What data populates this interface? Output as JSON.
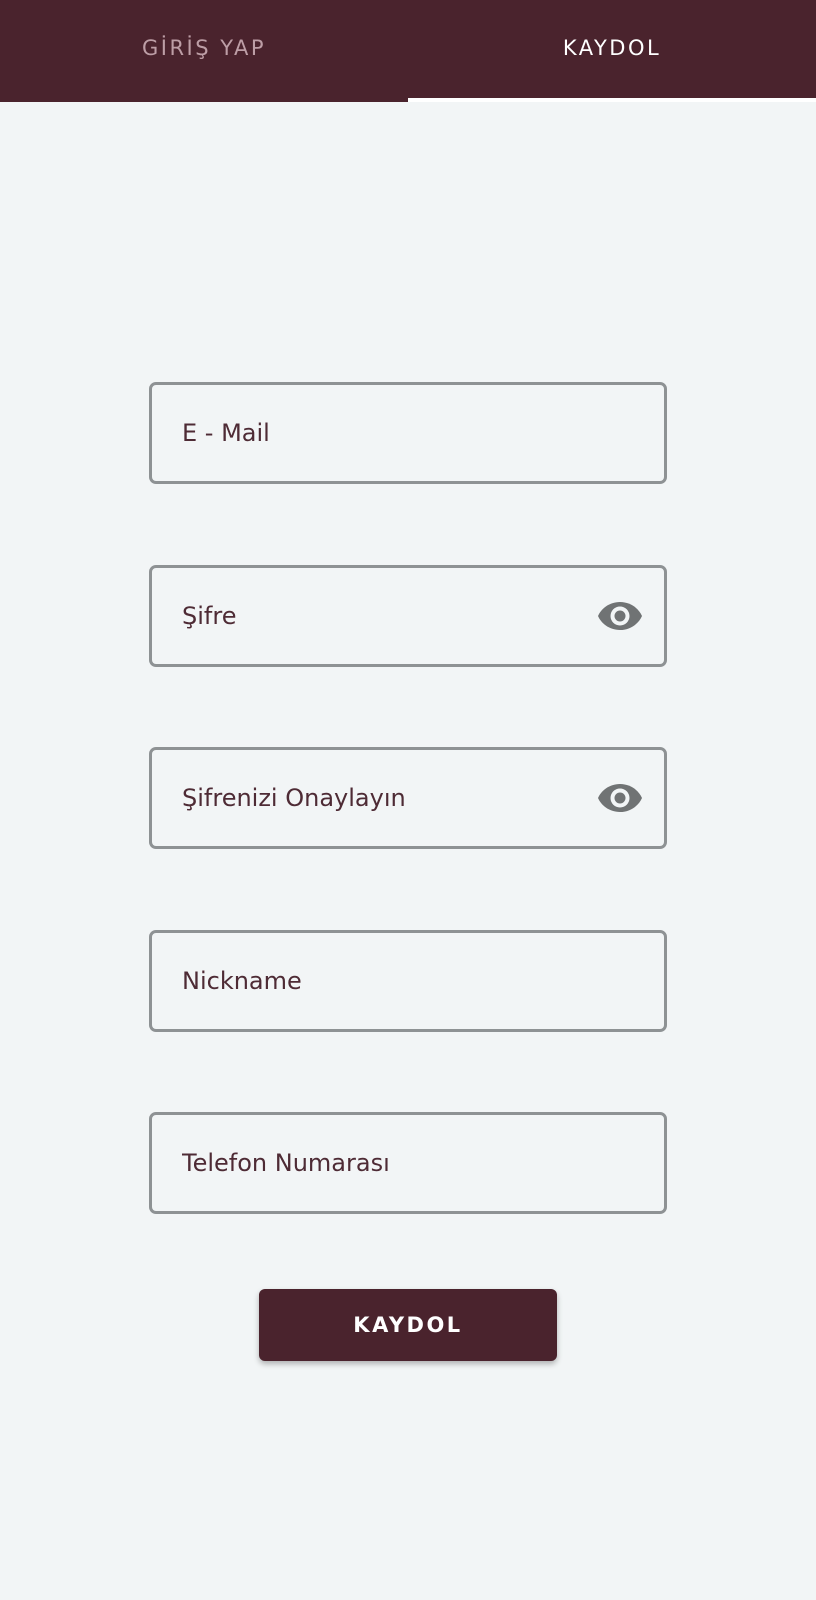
{
  "tabs": {
    "login_label": "GİRİŞ YAP",
    "signup_label": "KAYDOL",
    "active": "signup"
  },
  "form": {
    "email_placeholder": "E - Mail",
    "password_placeholder": "Şifre",
    "confirm_password_placeholder": "Şifrenizi Onaylayın",
    "nickname_placeholder": "Nickname",
    "phone_placeholder": "Telefon Numarası",
    "password_toggle_icon": "eye-icon",
    "confirm_toggle_icon": "eye-icon",
    "submit_label": "KAYDOL"
  },
  "colors": {
    "primary": "#4a232d",
    "background": "#f2f5f6",
    "field_border": "#8e9294",
    "inactive_tab_text": "#bd9ea6",
    "icon": "#707374"
  }
}
